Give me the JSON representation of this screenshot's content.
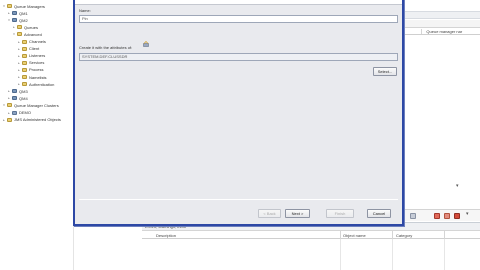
{
  "navigator": {
    "items": [
      {
        "label": "Queue Managers",
        "indent": 0,
        "icon": "folder-icon",
        "expanded": true
      },
      {
        "label": "QM1",
        "indent": 1,
        "icon": "queue-manager-icon",
        "expanded": false
      },
      {
        "label": "QM2",
        "indent": 1,
        "icon": "queue-manager-icon",
        "expanded": true
      },
      {
        "label": "Queues",
        "indent": 2,
        "icon": "folder-icon",
        "expanded": false
      },
      {
        "label": "Advanced",
        "indent": 2,
        "icon": "folder-icon",
        "expanded": true
      },
      {
        "label": "Channels",
        "indent": 3,
        "icon": "folder-icon",
        "expanded": false
      },
      {
        "label": "Client",
        "indent": 3,
        "icon": "folder-icon",
        "expanded": false
      },
      {
        "label": "Listeners",
        "indent": 3,
        "icon": "folder-icon",
        "expanded": false
      },
      {
        "label": "Services",
        "indent": 3,
        "icon": "folder-icon",
        "expanded": false
      },
      {
        "label": "Process",
        "indent": 3,
        "icon": "folder-icon",
        "expanded": false
      },
      {
        "label": "Namelists",
        "indent": 3,
        "icon": "folder-icon",
        "expanded": false
      },
      {
        "label": "Authentication",
        "indent": 3,
        "icon": "folder-icon",
        "expanded": false
      },
      {
        "label": "QM3",
        "indent": 1,
        "icon": "queue-manager-icon",
        "expanded": false
      },
      {
        "label": "QM4",
        "indent": 1,
        "icon": "queue-manager-icon",
        "expanded": false
      },
      {
        "label": "Queue Manager Clusters",
        "indent": 0,
        "icon": "folder-icon",
        "expanded": true
      },
      {
        "label": "DEMO",
        "indent": 1,
        "icon": "server-icon",
        "expanded": false
      },
      {
        "label": "JMS Administered Objects",
        "indent": 0,
        "icon": "folder-icon",
        "expanded": false
      }
    ]
  },
  "content_view": {
    "columns": [
      "",
      "Queue manager nar"
    ]
  },
  "properties_view": {
    "tab_label": "Errors, Warnings, Infos",
    "columns": [
      "Description",
      "Object name",
      "Category"
    ]
  },
  "wizard": {
    "name_label": "Name:",
    "name_value": "Pin",
    "attributes_label": "Create it with the attributes of:",
    "attributes_value": "SYSTEM.DEF.CLUSSDR",
    "select_button": "Select...",
    "back_button": "< Back",
    "next_button": "Next >",
    "finish_button": "Finish",
    "cancel_button": "Cancel"
  },
  "colors": {
    "dialog_border": "#2d48a5",
    "dialog_bg": "#e9eaee"
  }
}
